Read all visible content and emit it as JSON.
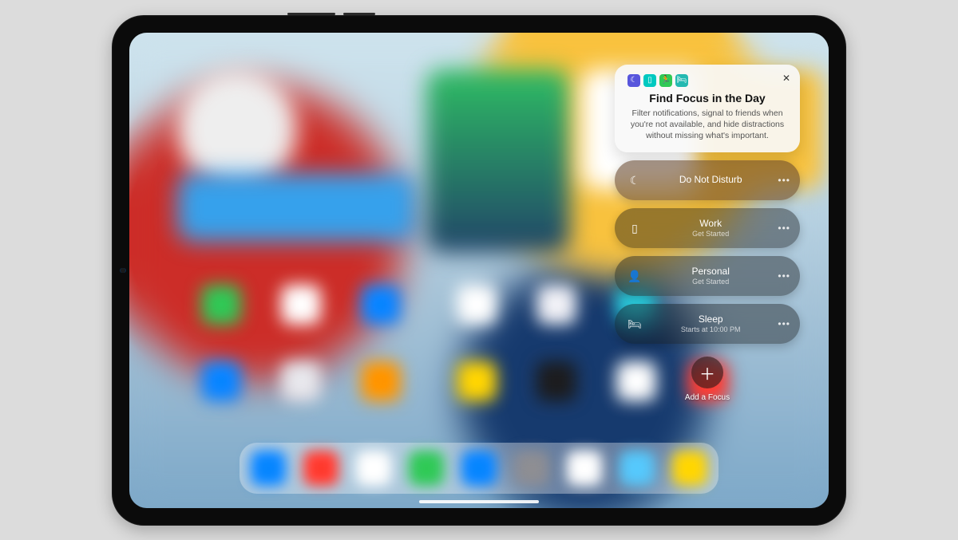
{
  "focus_card": {
    "title": "Find Focus in the Day",
    "description": "Filter notifications, signal to friends when you're not available, and hide distractions without missing what's important."
  },
  "focus_modes": [
    {
      "icon": "moon",
      "label": "Do Not Disturb",
      "sub": ""
    },
    {
      "icon": "badge",
      "label": "Work",
      "sub": "Get Started"
    },
    {
      "icon": "person",
      "label": "Personal",
      "sub": "Get Started"
    },
    {
      "icon": "bed",
      "label": "Sleep",
      "sub": "Starts at 10:00 PM"
    }
  ],
  "add_label": "Add a Focus",
  "more_glyph": "•••",
  "close_glyph": "✕",
  "plus_glyph": "＋"
}
